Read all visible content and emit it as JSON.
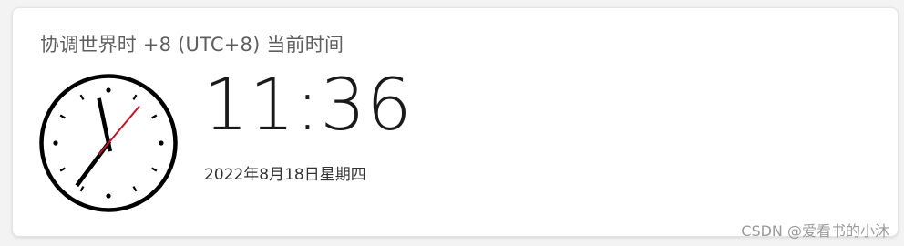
{
  "widget": {
    "title": "协调世界时 +8 (UTC+8) 当前时间",
    "time": "11:36",
    "date": "2022年8月18日星期四"
  },
  "clock": {
    "hours": 11,
    "minutes": 36,
    "seconds": 6,
    "hand_color": "#000000",
    "second_hand_color": "#c0142b",
    "face_color": "#ffffff",
    "rim_color": "#000000"
  },
  "watermark": {
    "text": "CSDN @爱看书的小沐"
  }
}
